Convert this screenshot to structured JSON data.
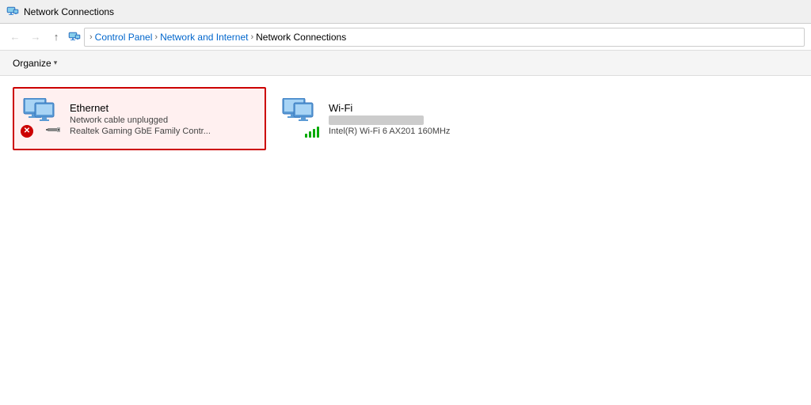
{
  "titleBar": {
    "title": "Network Connections",
    "icon": "network-connections-icon"
  },
  "addressBar": {
    "back": "←",
    "forward": "→",
    "up": "↑",
    "breadcrumb": [
      {
        "label": "Control Panel",
        "id": "control-panel"
      },
      {
        "label": "Network and Internet",
        "id": "network-internet"
      },
      {
        "label": "Network Connections",
        "id": "network-connections"
      }
    ]
  },
  "toolbar": {
    "organize_label": "Organize",
    "dropdown_symbol": "▾"
  },
  "adapters": [
    {
      "id": "ethernet",
      "name": "Ethernet",
      "status": "Network cable unplugged",
      "adapter": "Realtek Gaming GbE Family Contr...",
      "selected": true,
      "error": true
    },
    {
      "id": "wifi",
      "name": "Wi-Fi",
      "status_blurred": "████ ██████ ██████",
      "adapter": "Intel(R) Wi-Fi 6 AX201 160MHz",
      "selected": false,
      "error": false
    }
  ],
  "icons": {
    "back_arrow": "←",
    "forward_arrow": "→",
    "up_arrow": "↑",
    "separator": "›",
    "error_mark": "✕"
  }
}
